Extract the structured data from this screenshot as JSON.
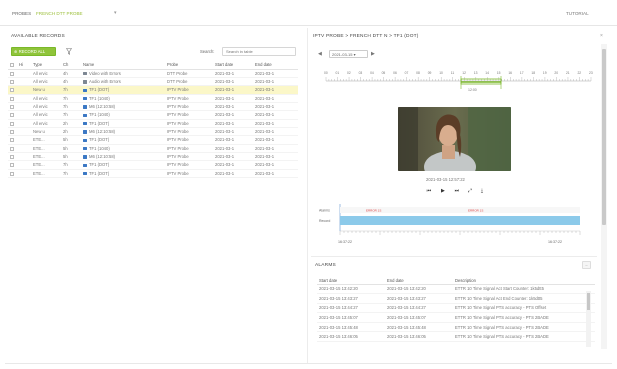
{
  "colors": {
    "accent_green": "#8fc43a",
    "selection": "#fbf7c8",
    "bar_blue": "#8ccaea",
    "line_blue": "#3b78c4"
  },
  "header": {
    "probes_label": "PROBES",
    "probe_value": "FRENCH DTT PROBE",
    "tutorial": "TUTORIAL"
  },
  "left": {
    "title": "AVAILABLE RECORDS",
    "new_record_button": "RECORD ALL",
    "search_label": "Search:",
    "search_placeholder": "Search in table",
    "columns": [
      "",
      "Hi",
      "Type",
      "Ch",
      "Name",
      "Probe",
      "Start date",
      "End date"
    ],
    "rows": [
      {
        "c1": "",
        "c2": "All ervic",
        "c3": "4h",
        "name": "Video with Errors",
        "icon": "grey",
        "probe": "DTT Probe",
        "start": "2021-03-1",
        "end": "2021-03-1",
        "selected": false
      },
      {
        "c1": "",
        "c2": "All ervic",
        "c3": "4h",
        "name": "Audio with Errors",
        "icon": "grey",
        "probe": "DTT Probe",
        "start": "2021-03-1",
        "end": "2021-03-1",
        "selected": false
      },
      {
        "c1": "",
        "c2": "New u",
        "c3": "7h",
        "name": "TF1 (DOT)",
        "icon": "blue",
        "probe": "IPTV Probe",
        "start": "2021-03-1",
        "end": "2021-03-1",
        "selected": true
      },
      {
        "c1": "",
        "c2": "All ervic",
        "c3": "7h",
        "name": "TF1 (1040)",
        "icon": "blue",
        "probe": "IPTV Probe",
        "start": "2021-03-1",
        "end": "2021-03-1",
        "selected": false
      },
      {
        "c1": "",
        "c2": "All ervic",
        "c3": "7h",
        "name": "M6 (12:10:58)",
        "icon": "blue",
        "probe": "IPTV Probe",
        "start": "2021-03-1",
        "end": "2021-03-1",
        "selected": false
      },
      {
        "c1": "",
        "c2": "All ervic",
        "c3": "7h",
        "name": "TF1 (1040)",
        "icon": "blue",
        "probe": "IPTV Probe",
        "start": "2021-03-1",
        "end": "2021-03-1",
        "selected": false
      },
      {
        "c1": "",
        "c2": "All ervic",
        "c3": "2h",
        "name": "TF1 (DOT)",
        "icon": "blue",
        "probe": "IPTV Probe",
        "start": "2021-03-1",
        "end": "2021-03-1",
        "selected": false
      },
      {
        "c1": "",
        "c2": "New u",
        "c3": "2h",
        "name": "M6 (12:10:58)",
        "icon": "blue",
        "probe": "IPTV Probe",
        "start": "2021-03-1",
        "end": "2021-03-1",
        "selected": false
      },
      {
        "c1": "",
        "c2": "ETE...",
        "c3": "5h",
        "name": "TF1 (DOT)",
        "icon": "blue",
        "probe": "IPTV Probe",
        "start": "2021-03-1",
        "end": "2021-03-1",
        "selected": false
      },
      {
        "c1": "",
        "c2": "ETE...",
        "c3": "5h",
        "name": "TF1 (1040)",
        "icon": "blue",
        "probe": "IPTV Probe",
        "start": "2021-03-1",
        "end": "2021-03-1",
        "selected": false
      },
      {
        "c1": "",
        "c2": "ETE...",
        "c3": "5h",
        "name": "M6 (12:10:58)",
        "icon": "blue",
        "probe": "IPTV Probe",
        "start": "2021-03-1",
        "end": "2021-03-1",
        "selected": false
      },
      {
        "c1": "",
        "c2": "ETE...",
        "c3": "7h",
        "name": "TF1 (DOT)",
        "icon": "blue",
        "probe": "IPTV Probe",
        "start": "2021-03-1",
        "end": "2021-03-1",
        "selected": false
      },
      {
        "c1": "",
        "c2": "ETE...",
        "c3": "7h",
        "name": "TF1 (DOT)",
        "icon": "blue",
        "probe": "IPTV Probe",
        "start": "2021-03-1",
        "end": "2021-03-1",
        "selected": false
      }
    ]
  },
  "right": {
    "title": "IPTV PROBE > FRENCH DTT N > TF1 (DOT)",
    "current_date": "2021-03-15",
    "timeline_labels": [
      "00",
      "01",
      "02",
      "03",
      "04",
      "05",
      "06",
      "07",
      "08",
      "09",
      "10",
      "11",
      "12",
      "13",
      "14",
      "15",
      "16",
      "17",
      "18",
      "19",
      "20",
      "21",
      "22",
      "23"
    ],
    "timeline_highlight_label": "12:00",
    "video_timestamp": "2021-03-15 12:57:22",
    "player_icons": [
      "skip-back-icon",
      "play-icon",
      "skip-forward-icon",
      "fullscreen-icon",
      "download-icon"
    ],
    "track_labels": [
      "Alarms",
      "Record"
    ],
    "track_error_labels": [
      "ERROR 1S",
      "ERROR 1S"
    ],
    "range_start": "16:37:22",
    "range_end": "16:37:22",
    "alarms": {
      "title": "ALARMS",
      "columns": [
        "Start date",
        "End date",
        "Description"
      ],
      "rows": [
        {
          "start": "2021-03-15 13:42:20",
          "end": "2021-03-15 13:42:20",
          "desc": "ETTR 10 Time Signal Act Start Counter: 1k5dtt5"
        },
        {
          "start": "2021-03-15 13:43:27",
          "end": "2021-03-15 13:43:27",
          "desc": "ETTR 10 Time Signal Act End Counter: 1k5dtt5"
        },
        {
          "start": "2021-03-15 13:44:27",
          "end": "2021-03-15 13:44:27",
          "desc": "ETTR 10 Time Signal PTS accuracy - PTS Offset"
        },
        {
          "start": "2021-03-15 13:45:07",
          "end": "2021-03-15 13:45:07",
          "desc": "ETTR 10 Time Signal PTS accuracy - PTS 2BADE"
        },
        {
          "start": "2021-03-15 13:45:48",
          "end": "2021-03-15 13:45:48",
          "desc": "ETTR 10 Time Signal PTS accuracy - PTS 2BADE"
        },
        {
          "start": "2021-03-15 13:46:05",
          "end": "2021-03-15 13:46:05",
          "desc": "ETTR 10 Time Signal PTS accuracy - PTS 2BADE"
        }
      ]
    }
  }
}
